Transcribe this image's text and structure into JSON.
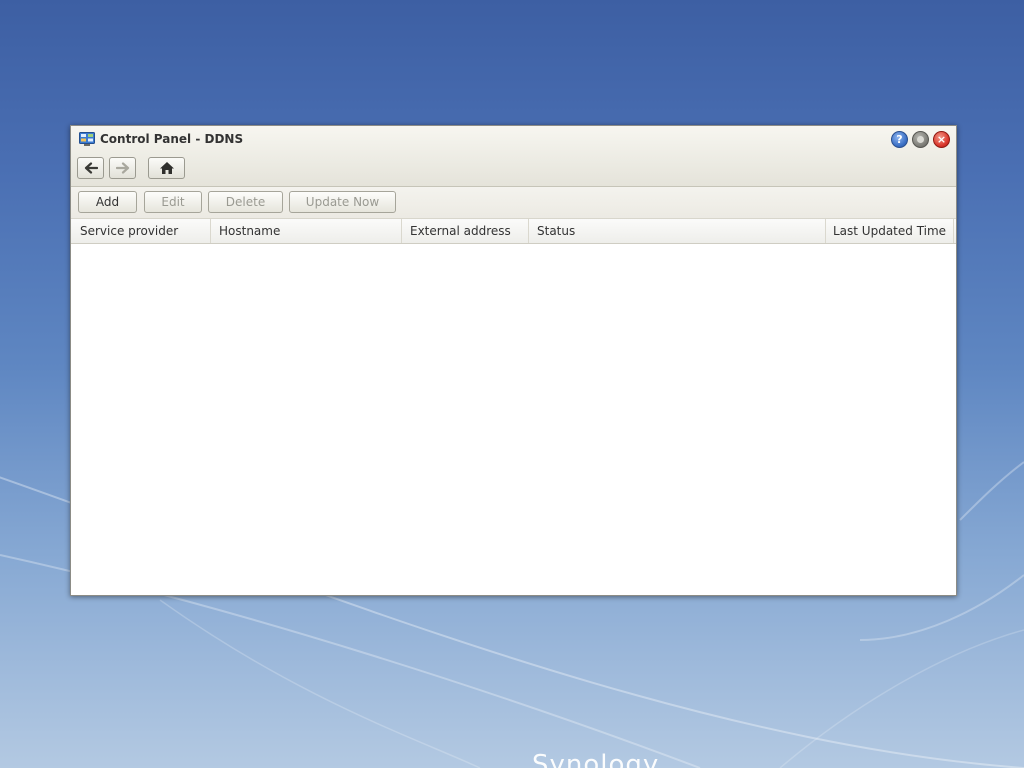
{
  "desktop": {
    "brand_text": "Synology"
  },
  "window": {
    "title": "Control Panel - DDNS",
    "controls": {
      "help_glyph": "?",
      "close_glyph": "×"
    }
  },
  "icons": {
    "app": "control-panel-icon",
    "back": "arrow-left-icon",
    "forward": "arrow-right-icon",
    "home": "home-icon",
    "help": "help-icon",
    "minimize": "minimize-icon",
    "close": "close-icon"
  },
  "toolbar": {
    "add_label": "Add",
    "edit_label": "Edit",
    "delete_label": "Delete",
    "update_label": "Update Now"
  },
  "grid": {
    "columns": [
      "Service provider",
      "Hostname",
      "External address",
      "Status",
      "Last Updated Time"
    ],
    "rows": []
  },
  "colors": {
    "desktop_top": "#3d5fa3",
    "desktop_bottom": "#b3c9e2",
    "window_chrome": "#ecebe3",
    "help_blue": "#3a6fc4",
    "close_red": "#d9352a",
    "disabled_text": "#9a9a92"
  }
}
